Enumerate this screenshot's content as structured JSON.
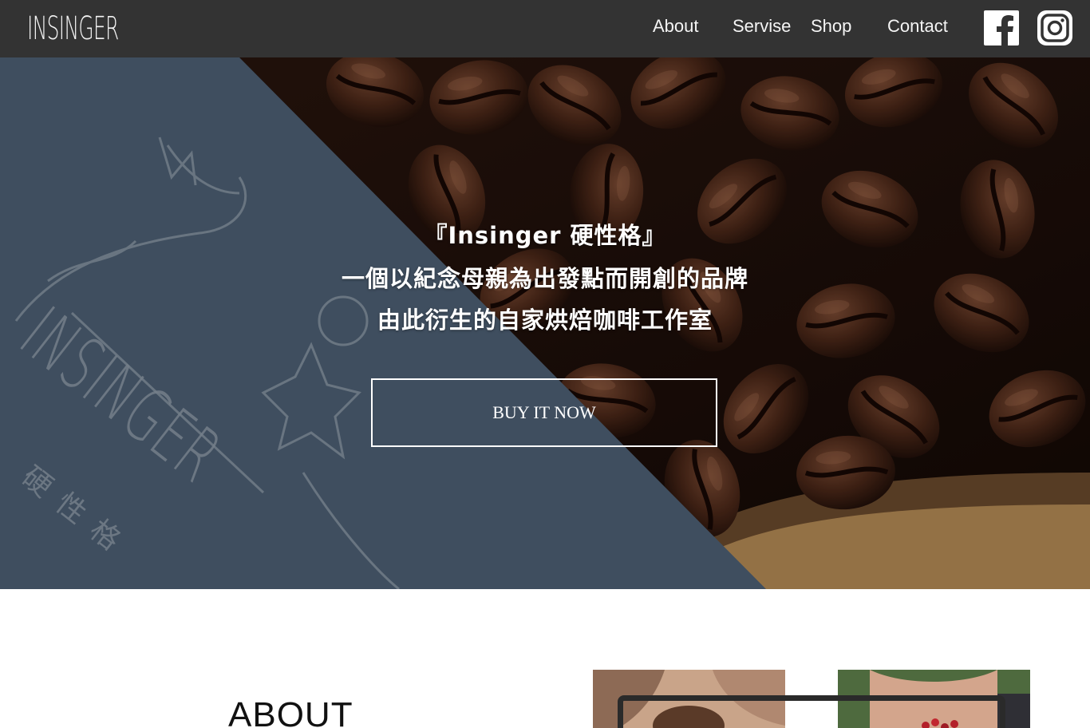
{
  "nav": {
    "logo": "INSINGER",
    "links": [
      "About",
      "Servise",
      "Shop",
      "Contact"
    ],
    "social": [
      "facebook-icon",
      "instagram-icon"
    ]
  },
  "hero": {
    "title": "『Insinger 硬性格』",
    "line2": "一個以紀念母親為出發點而開創的品牌",
    "line3": "由此衍生的自家烘焙咖啡工作室",
    "button": "BUY IT NOW",
    "box_text": "INSINGER",
    "box_sub": "硬性格"
  },
  "about": {
    "heading": "ABOUT"
  },
  "colors": {
    "nav_bg": "#333333",
    "box_blue": "#55697e",
    "coffee": "#3b2016"
  }
}
